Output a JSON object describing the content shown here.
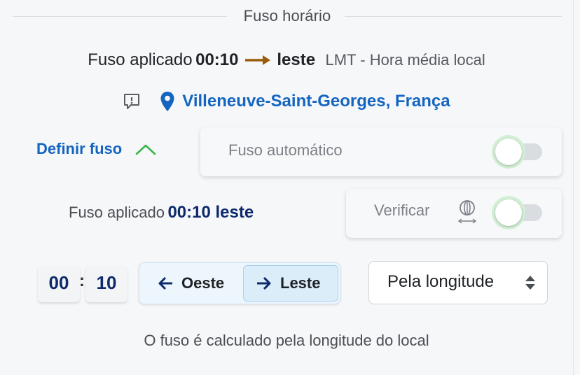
{
  "section": {
    "title": "Fuso horário"
  },
  "applied": {
    "prefix": "Fuso aplicado",
    "offset": "00:10",
    "direction": "leste",
    "type": "LMT - Hora média local"
  },
  "location": {
    "name": "Villeneuve-Saint-Georges, França"
  },
  "define": {
    "label": "Definir fuso"
  },
  "auto": {
    "label": "Fuso automático",
    "enabled": false
  },
  "verify": {
    "label": "Verificar",
    "enabled": false
  },
  "applied_small": {
    "label": "Fuso aplicado",
    "value": "00:10 leste"
  },
  "offset_input": {
    "hours": "00",
    "separator": ":",
    "minutes": "10"
  },
  "direction_toggle": {
    "west_label": "Oeste",
    "east_label": "Leste",
    "selected": "east"
  },
  "method_select": {
    "selected": "Pela longitude"
  },
  "hint": "O fuso é calculado pela longitude do local",
  "colors": {
    "accent_blue": "#1565c0",
    "dark_navy": "#0d2a6b",
    "arrow_brown": "#9a5b0a",
    "toggle_halo": "#d3efd5",
    "chevron_green": "#3ab54a"
  },
  "icons": {
    "arrow": "arrow-right-icon",
    "feedback": "feedback-icon",
    "pin": "map-pin-icon",
    "chevron": "chevron-up-icon",
    "globe": "globe-arrows-icon",
    "west": "arrow-left-icon",
    "east": "arrow-right-icon",
    "select": "updown-caret-icon"
  }
}
